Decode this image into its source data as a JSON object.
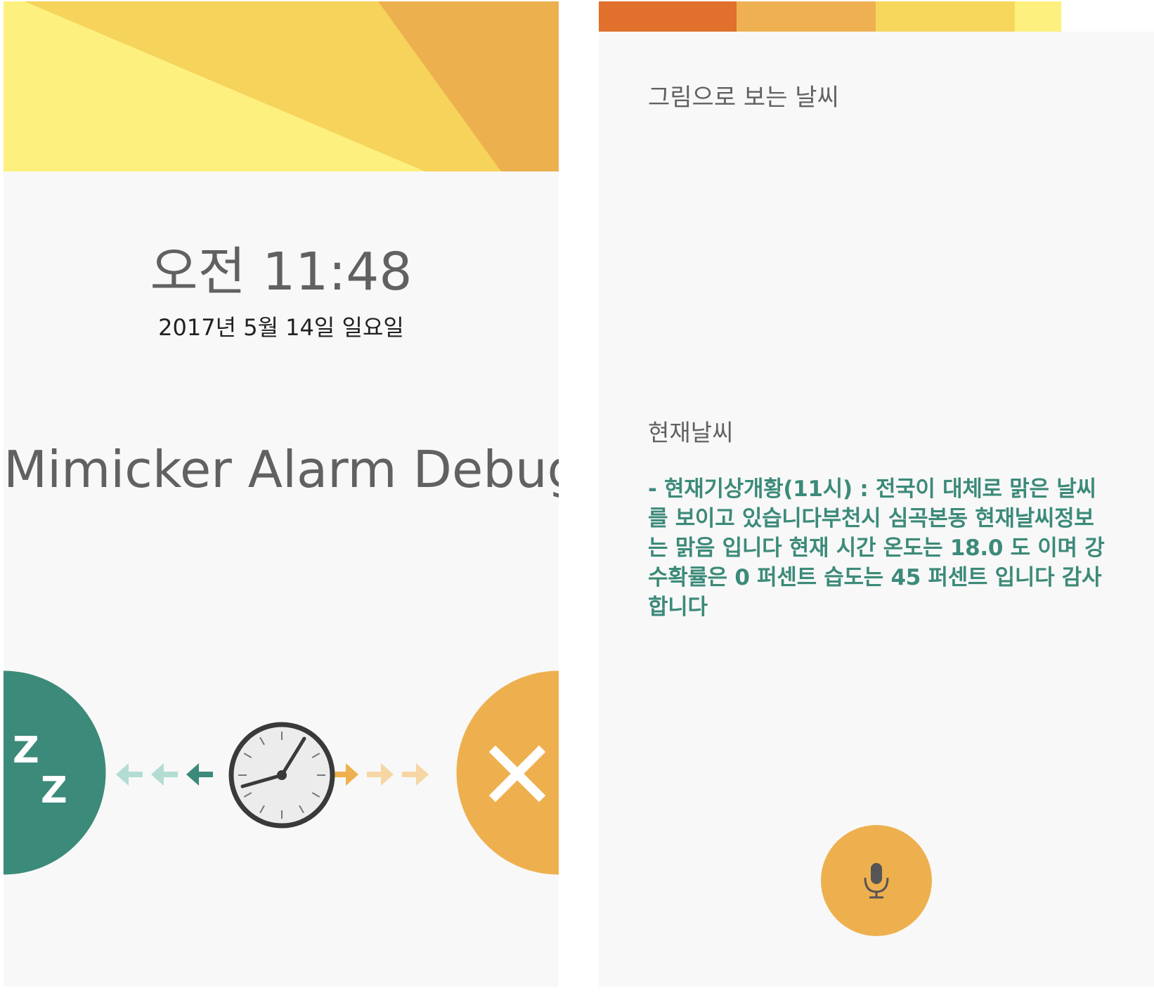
{
  "colors": {
    "teal": "#3c8a79",
    "amber": "#eeb04e",
    "banner_yellow": "#fdf07f",
    "banner_gold": "#f6d35b",
    "banner_orange": "#edb04f",
    "progress": [
      "#e0702c",
      "#efb052",
      "#f7d75b",
      "#fdf07f"
    ],
    "background": "#f8f8f8"
  },
  "alarm_screen": {
    "time": "오전 11:48",
    "date": "2017년 5월 14일 일요일",
    "alarm_name": "Mimicker Alarm Debug",
    "snooze_icon": "snooze-zz-icon",
    "snooze_label": "Z",
    "dismiss_icon": "close-x-icon",
    "clock_icon": "analog-clock-icon"
  },
  "weather_screen": {
    "picture_title": "그림으로 보는 날씨",
    "current_title": "현재날씨",
    "current_text": "- 현재기상개황(11시) : 전국이 대체로 맑은 날씨를 보이고 있습니다부천시 심곡본동 현재날씨정보는 맑음 입니다 현재 시간 온도는 18.0 도 이며 강수확률은 0 퍼센트 습도는 45 퍼센트 입니다 감사합니다",
    "mic_icon": "microphone-icon"
  }
}
